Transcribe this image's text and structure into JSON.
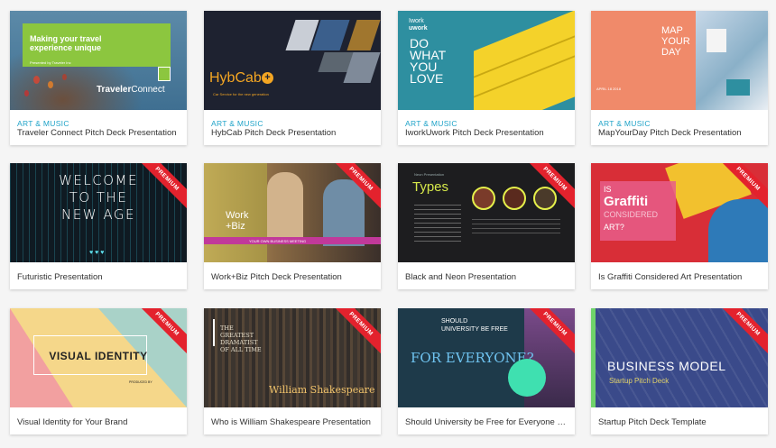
{
  "cards": [
    {
      "category": "ART & MUSIC",
      "title": "Traveler Connect Pitch Deck Presentation",
      "thumb": {
        "headline": "Making your travel experience unique",
        "sub": "Presented by Traveler Inc",
        "brand_a": "Traveler",
        "brand_b": "Connect"
      }
    },
    {
      "category": "ART & MUSIC",
      "title": "HybCab Pitch Deck Presentation",
      "thumb": {
        "brand": "HybCab",
        "sub": "Car Service for the new generation"
      }
    },
    {
      "category": "ART & MUSIC",
      "title": "IworkUwork Pitch Deck Presentation",
      "thumb": {
        "logo_a": "Iwork",
        "logo_b": "uwork",
        "lines": [
          "DO",
          "WHAT",
          "YOU",
          "LOVE"
        ]
      }
    },
    {
      "category": "ART & MUSIC",
      "title": "MapYourDay Pitch Deck Presentation",
      "thumb": {
        "lines": [
          "MAP",
          "YOUR",
          "DAY"
        ],
        "date": "APRIL 18 2018"
      }
    },
    {
      "title": "Futuristic Presentation",
      "badge": "PREMIUM",
      "thumb": {
        "lines": [
          "WELCOME",
          "TO THE",
          "NEW AGE"
        ]
      }
    },
    {
      "title": "Work+Biz Pitch Deck Presentation",
      "badge": "PREMIUM",
      "thumb": {
        "word_a": "Work",
        "word_b": "+Biz",
        "bar": "YOUR OWN BUSINESS MEETING"
      }
    },
    {
      "title": "Black and Neon Presentation",
      "badge": "PREMIUM",
      "thumb": {
        "heading": "Types",
        "kicker": "Neon Presentation"
      }
    },
    {
      "title": "Is Graffiti Considered Art Presentation",
      "badge": "PREMIUM",
      "thumb": {
        "lines": [
          "IS",
          "Graffiti",
          "CONSIDERED",
          "ART?"
        ]
      }
    },
    {
      "title": "Visual Identity for Your Brand",
      "badge": "PREMIUM",
      "thumb": {
        "heading": "VISUAL IDENTITY",
        "sub": "PRODUCED BY"
      }
    },
    {
      "title": "Who is William Shakespeare Presentation",
      "badge": "PREMIUM",
      "thumb": {
        "lines": [
          "THE",
          "GREATEST",
          "DRAMATIST",
          "OF ALL TIME"
        ],
        "name": "William Shakespeare"
      }
    },
    {
      "title": "Should University be Free for Everyone Presentation",
      "badge": "PREMIUM",
      "thumb": {
        "lines": [
          "SHOULD",
          "UNIVERSITY BE FREE"
        ],
        "big": "FOR EVERYONE?"
      }
    },
    {
      "title": "Startup Pitch Deck Template",
      "badge": "PREMIUM",
      "thumb": {
        "heading": "BUSINESS MODEL",
        "sub": "Startup Pitch Deck"
      }
    }
  ]
}
